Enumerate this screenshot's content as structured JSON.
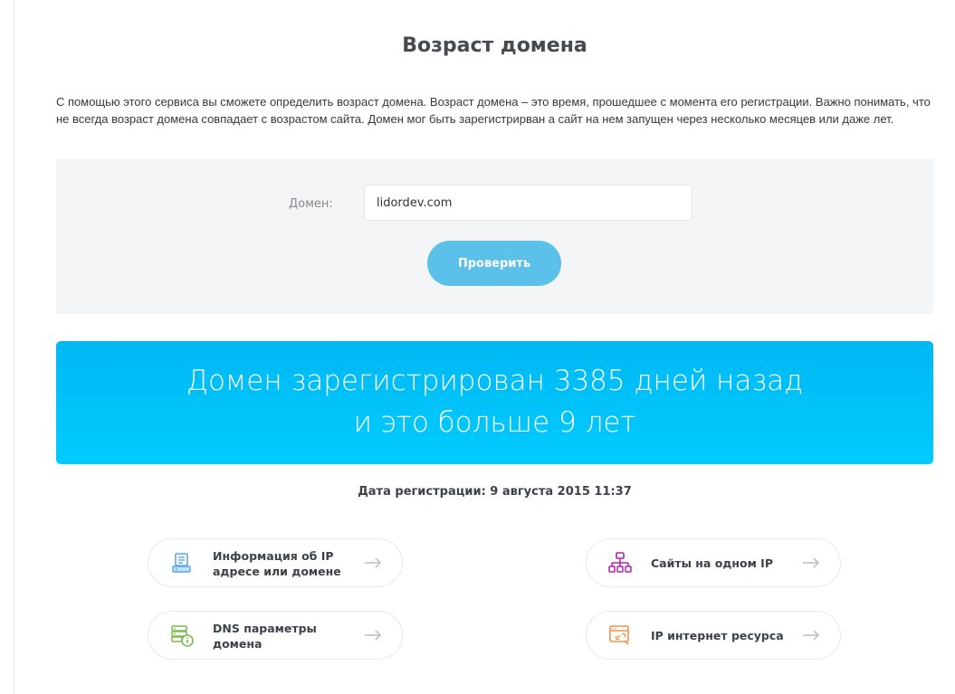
{
  "page": {
    "title": "Возраст домена",
    "intro": "С помощью этого сервиса вы сможете определить возраст домена. Возраст домена – это время, прошедшее с момента его регистрации. Важно понимать, что не всегда возраст домена совпадает с возрастом сайта. Домен мог быть зарегистрирван а сайт на нем запущен через несколько месяцев или даже лет."
  },
  "form": {
    "domain_label": "Домен:",
    "domain_value": "lidordev.com",
    "submit_label": "Проверить"
  },
  "result": {
    "line1": "Домен зарегистрирован 3385 дней назад",
    "line2": "и это больше 9 лет",
    "registration_date": "Дата регистрации: 9 августа 2015 11:37"
  },
  "services": [
    {
      "label_line1": "Информация об IP",
      "label_line2": "адресе или домене",
      "icon": "server-doc-icon",
      "color": "#5aa9e6"
    },
    {
      "label_line1": "Сайты на одном IP",
      "label_line2": "",
      "icon": "sitemap-icon",
      "color": "#b021b0"
    },
    {
      "label_line1": "DNS параметры",
      "label_line2": "домена",
      "icon": "dns-info-icon",
      "color": "#7cbb4c"
    },
    {
      "label_line1": "IP интернет ресурса",
      "label_line2": "",
      "icon": "browser-link-icon",
      "color": "#f0944a"
    }
  ],
  "colors": {
    "accent": "#5bc0ea",
    "banner": "#00c2fb",
    "panel": "#f3f5f6",
    "text": "#3c4248"
  }
}
